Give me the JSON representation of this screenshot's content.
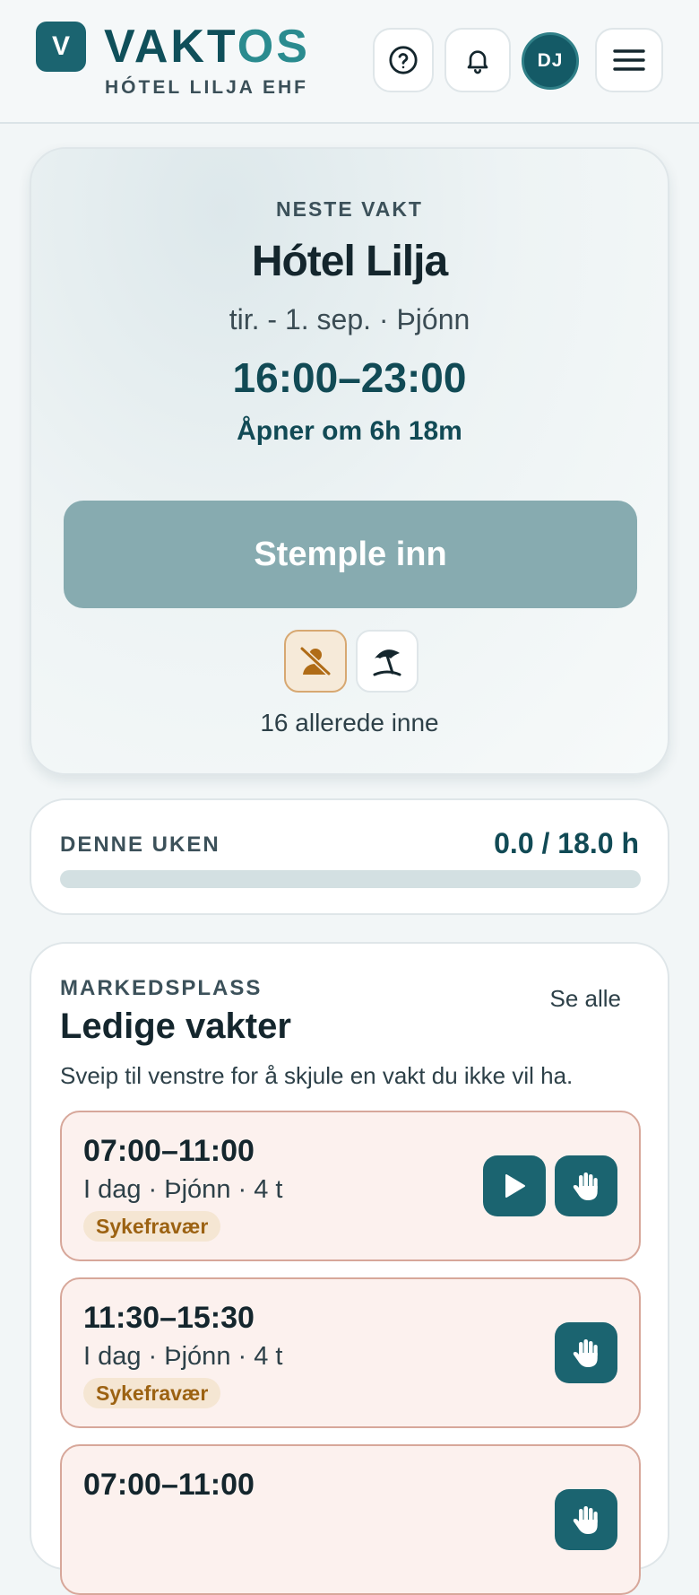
{
  "header": {
    "logo_letter": "V",
    "brand_main": "VAKT",
    "brand_accent": "OS",
    "subtitle": "HÓTEL LILJA EHF",
    "avatar_initials": "DJ",
    "icons": [
      "help-icon",
      "bell-icon",
      "menu-icon"
    ]
  },
  "next_shift": {
    "eyebrow": "NESTE VAKT",
    "venue": "Hótel Lilja",
    "meta": "tir. - 1. sep. · Þjónn",
    "time": "16:00–23:00",
    "opens": "Åpner om 6h 18m",
    "clock_in_label": "Stemple inn",
    "already_in": "16 allerede inne",
    "icons": [
      "person-off-icon",
      "beach-umbrella-icon"
    ]
  },
  "week": {
    "label": "DENNE UKEN",
    "value": "0.0 / 18.0 h",
    "progress": 0.0
  },
  "marketplace": {
    "eyebrow": "MARKEDSPLASS",
    "title": "Ledige vakter",
    "see_all": "Se alle",
    "hint": "Sveip til venstre for å skjule en vakt du ikke vil ha.",
    "shifts": [
      {
        "time": "07:00–11:00",
        "meta": "I dag · Þjónn · 4 t",
        "badge": "Sykefravær"
      },
      {
        "time": "11:30–15:30",
        "meta": "I dag · Þjónn · 4 t",
        "badge": "Sykefravær"
      },
      {
        "time": "07:00–11:00",
        "meta": "",
        "badge": ""
      }
    ]
  },
  "colors": {
    "brand": "#1b6470",
    "brand_dark": "#0f4f5a",
    "clock_in_disabled": "#87abb0",
    "shift_bg": "#fcf1ee",
    "shift_border": "#d7a79a",
    "badge_text": "#9c6212"
  }
}
